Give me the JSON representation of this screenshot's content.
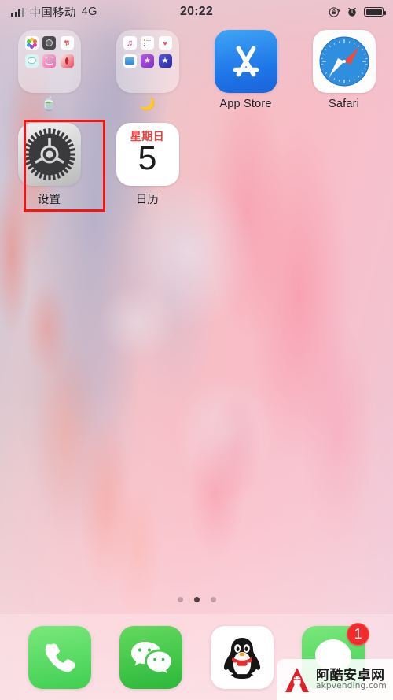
{
  "status_bar": {
    "signal_icon": "signal-bars-icon",
    "carrier": "中国移动",
    "network_type": "4G",
    "time": "20:22",
    "rotation_lock_icon": "rotation-lock-icon",
    "alarm_icon": "alarm-clock-icon",
    "battery_icon": "battery-full-icon"
  },
  "home_screen": {
    "row1": [
      {
        "type": "folder",
        "name": "folder-1",
        "label": "🍵",
        "mini_icons": [
          {
            "name": "photos-icon",
            "glyph": ""
          },
          {
            "name": "camera-icon",
            "glyph": ""
          },
          {
            "name": "festival-app-icon",
            "glyph": "节"
          },
          {
            "name": "teal-app-icon",
            "glyph": ""
          },
          {
            "name": "instagram-icon",
            "glyph": ""
          },
          {
            "name": "red-app-icon",
            "glyph": ""
          }
        ]
      },
      {
        "type": "folder",
        "name": "folder-2",
        "label": "🌙",
        "mini_icons": [
          {
            "name": "music-icon",
            "glyph": "♫"
          },
          {
            "name": "reminders-icon",
            "glyph": ""
          },
          {
            "name": "health-icon",
            "glyph": "♥"
          },
          {
            "name": "files-icon",
            "glyph": ""
          },
          {
            "name": "imovie-icon",
            "glyph": "★"
          },
          {
            "name": "itunes-store-icon",
            "glyph": "★"
          }
        ]
      },
      {
        "type": "app",
        "name": "app-store",
        "label": "App Store",
        "icon": "app-store-icon"
      },
      {
        "type": "app",
        "name": "safari",
        "label": "Safari",
        "icon": "safari-compass-icon"
      }
    ],
    "row2": [
      {
        "type": "app",
        "name": "settings",
        "label": "设置",
        "icon": "settings-gear-icon",
        "highlighted": true
      },
      {
        "type": "app",
        "name": "calendar",
        "label": "日历",
        "icon": "calendar-icon",
        "day_of_week": "星期日",
        "day_number": "5"
      }
    ],
    "highlight_color": "#f31414"
  },
  "page_dots": {
    "count": 3,
    "active_index": 1
  },
  "dock": {
    "items": [
      {
        "name": "phone",
        "icon": "phone-handset-icon",
        "badge": ""
      },
      {
        "name": "wechat",
        "icon": "wechat-bubbles-icon",
        "badge": ""
      },
      {
        "name": "qq",
        "icon": "qq-penguin-icon",
        "badge": ""
      },
      {
        "name": "messages",
        "icon": "messages-bubble-icon",
        "badge": "1"
      }
    ]
  },
  "watermark": {
    "logo_icon": "android-a-logo-icon",
    "site_name": "阿酷安卓网",
    "site_url": "akpvending.com"
  }
}
